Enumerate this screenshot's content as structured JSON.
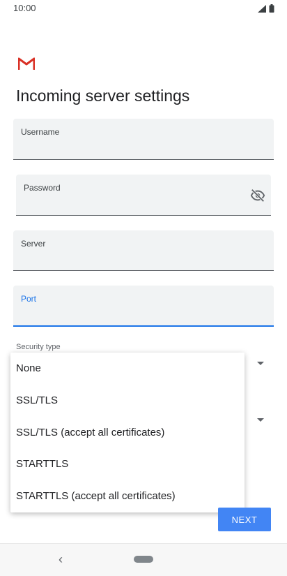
{
  "status_bar": {
    "time": "10:00"
  },
  "page": {
    "title": "Incoming server settings"
  },
  "fields": {
    "username": {
      "label": "Username",
      "value": ""
    },
    "password": {
      "label": "Password",
      "value": ""
    },
    "server": {
      "label": "Server",
      "value": ""
    },
    "port": {
      "label": "Port",
      "value": ""
    }
  },
  "security_type": {
    "label": "Security type",
    "options": [
      "None",
      "SSL/TLS",
      "SSL/TLS (accept all certificates)",
      "STARTTLS",
      "STARTTLS (accept all certificates)"
    ]
  },
  "actions": {
    "next_label": "NEXT"
  },
  "colors": {
    "accent": "#1a73e8",
    "button": "#4285f4",
    "field_bg": "#f1f3f4",
    "gmail_red": "#d93025"
  }
}
